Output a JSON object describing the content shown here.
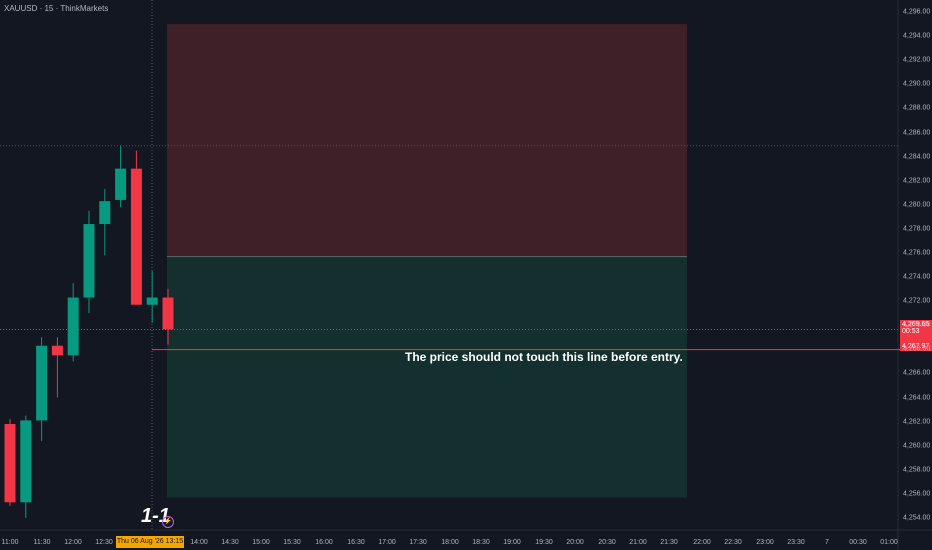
{
  "header": {
    "symbol": "XAUUSD · 15 · ThinkMarkets"
  },
  "annotations": {
    "note": "The price should not touch this line before entry.",
    "marker": "1-1",
    "bolt_icon": "⚡"
  },
  "price_tags": {
    "current": "4,269.65",
    "countdown": "00:53",
    "line": "4,267.97"
  },
  "date_tag": "Thu 06 Aug '26   13:15",
  "colors": {
    "bg": "#131722",
    "up": "#089981",
    "down": "#f23645",
    "stop_zone": "#3f1f28",
    "target_zone": "#14302e",
    "grid": "#1e2230"
  },
  "chart_data": {
    "type": "candlestick",
    "symbol": "XAUUSD",
    "timeframe": "15",
    "ylim": [
      4253,
      4297
    ],
    "y_ticks": [
      4254,
      4256,
      4258,
      4260,
      4262,
      4264,
      4266,
      4268,
      4270,
      4272,
      4274,
      4276,
      4278,
      4280,
      4282,
      4284,
      4286,
      4288,
      4290,
      4292,
      4294,
      4296
    ],
    "y_tick_labels": [
      "4,254.00",
      "4,256.00",
      "4,258.00",
      "4,260.00",
      "4,262.00",
      "4,264.00",
      "4,266.00",
      "4,268.00",
      "4,270.00",
      "4,272.00",
      "4,274.00",
      "4,276.00",
      "4,278.00",
      "4,280.00",
      "4,282.00",
      "4,284.00",
      "4,286.00",
      "4,288.00",
      "4,290.00",
      "4,292.00",
      "4,294.00",
      "4,296.00"
    ],
    "x_tick_labels": [
      "11:00",
      "11:30",
      "12:00",
      "12:30",
      "13:15",
      "14:00",
      "14:30",
      "15:00",
      "15:30",
      "16:00",
      "16:30",
      "17:00",
      "17:30",
      "18:00",
      "18:30",
      "19:00",
      "19:30",
      "20:00",
      "20:30",
      "21:00",
      "21:30",
      "22:00",
      "22:30",
      "23:00",
      "23:30",
      "7",
      "00:30",
      "01:00"
    ],
    "candles": [
      {
        "o": 4261.8,
        "h": 4262.2,
        "l": 4255.0,
        "c": 4255.3
      },
      {
        "o": 4255.3,
        "h": 4262.5,
        "l": 4254.0,
        "c": 4262.1
      },
      {
        "o": 4262.1,
        "h": 4269.0,
        "l": 4260.4,
        "c": 4268.3
      },
      {
        "o": 4268.3,
        "h": 4269.0,
        "l": 4264.0,
        "c": 4267.5
      },
      {
        "o": 4267.5,
        "h": 4273.5,
        "l": 4267.0,
        "c": 4272.3
      },
      {
        "o": 4272.3,
        "h": 4279.5,
        "l": 4271.0,
        "c": 4278.4
      },
      {
        "o": 4278.4,
        "h": 4281.3,
        "l": 4275.8,
        "c": 4280.3
      },
      {
        "o": 4280.4,
        "h": 4284.9,
        "l": 4279.8,
        "c": 4283.0
      },
      {
        "o": 4283.0,
        "h": 4284.5,
        "l": 4271.8,
        "c": 4271.7
      },
      {
        "o": 4271.7,
        "h": 4274.5,
        "l": 4270.2,
        "c": 4272.3
      },
      {
        "o": 4272.3,
        "h": 4273.0,
        "l": 4268.4,
        "c": 4269.65
      }
    ],
    "position": {
      "stop_top": 4295.0,
      "entry": 4275.7,
      "target": 4255.7
    },
    "horizontal_lines": [
      4284.9,
      4269.65,
      4267.97
    ],
    "current_price": 4269.65,
    "line_price": 4267.97
  }
}
